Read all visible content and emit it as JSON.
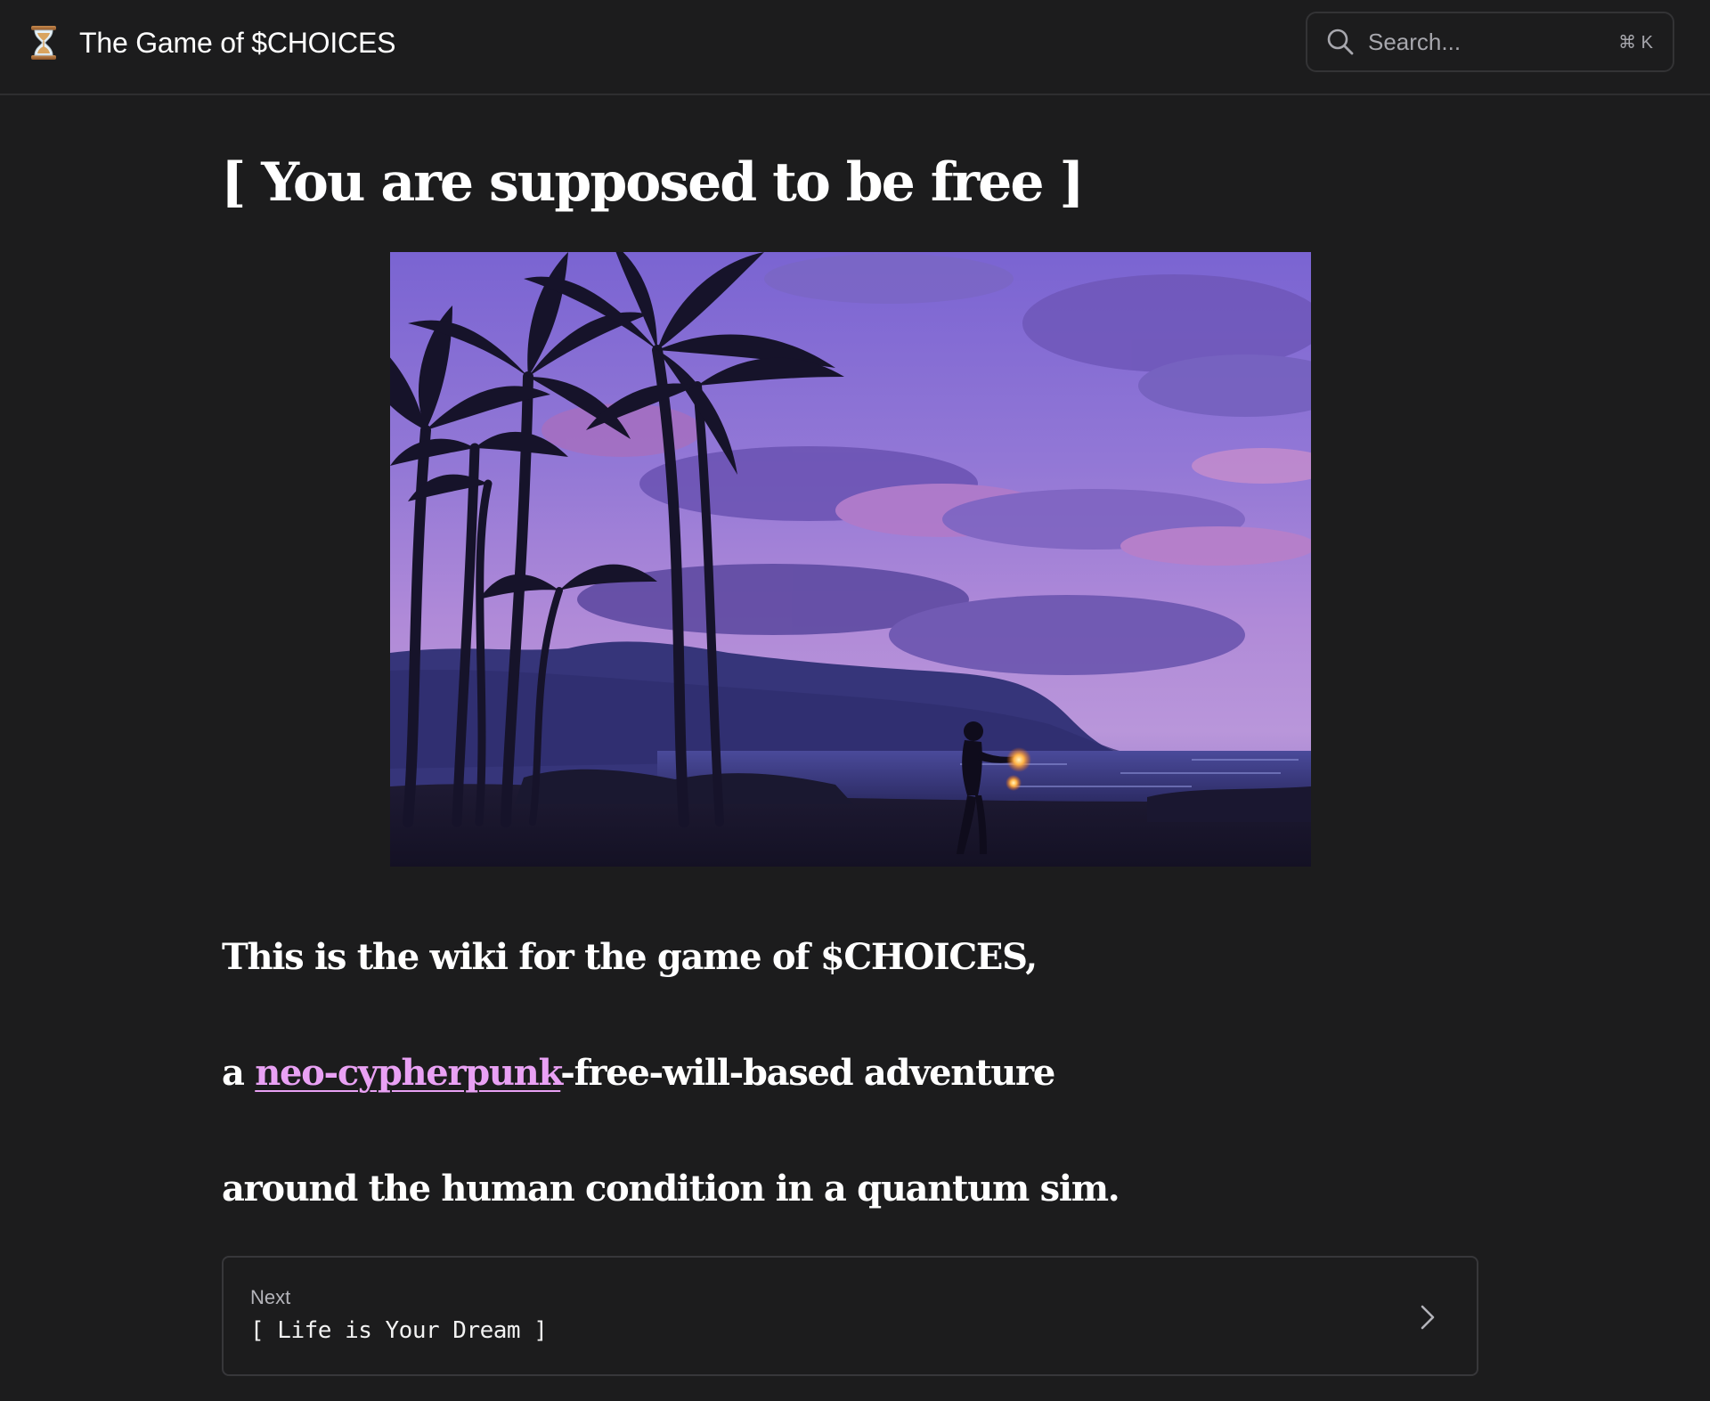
{
  "header": {
    "site_title": "The Game of $CHOICES",
    "logo_icon": "hourglass-icon",
    "search": {
      "placeholder": "Search...",
      "shortcut": "⌘ K"
    }
  },
  "article": {
    "title": "[ You are supposed to be free ]",
    "hero_image": "sunset-beach-palms-fire-dancer",
    "paragraphs": {
      "line1": "This is the wiki for the game of $CHOICES,",
      "line2_prefix": "a ",
      "line2_link": "neo-cypherpunk",
      "line2_suffix": "-free-will-based adventure",
      "line3": "around the human condition in a quantum sim."
    }
  },
  "pagination": {
    "next_label": "Next",
    "next_title": "[ Life is Your Dream ]",
    "chevron_icon": "chevron-right-icon"
  },
  "colors": {
    "background": "#1c1c1d",
    "link": "#e9a1f4",
    "text": "#ffffff"
  }
}
